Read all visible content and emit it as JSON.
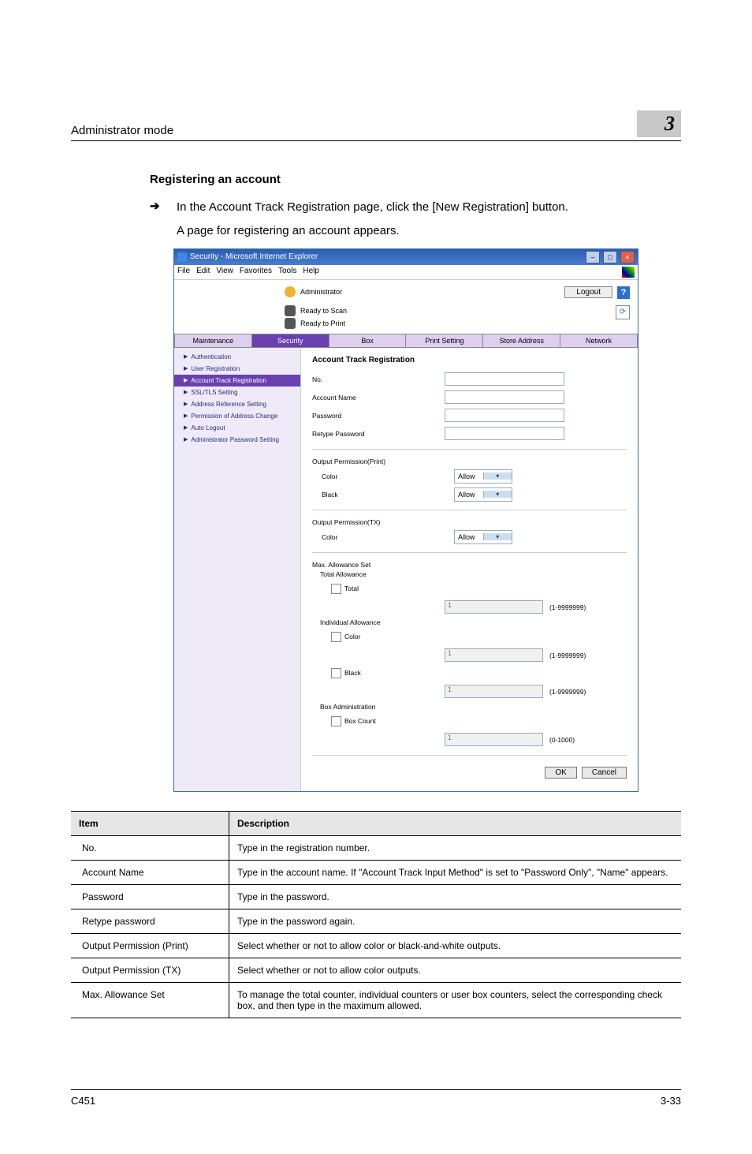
{
  "header": {
    "title": "Administrator mode",
    "chapter": "3"
  },
  "section_heading": "Registering an account",
  "step1": "In the Account Track Registration page, click the [New Registration] button.",
  "step1b": "A page for registering an account appears.",
  "ie": {
    "title": "Security - Microsoft Internet Explorer",
    "menu": {
      "file": "File",
      "edit": "Edit",
      "view": "View",
      "favorites": "Favorites",
      "tools": "Tools",
      "help": "Help"
    },
    "admin": "Administrator",
    "ready_scan": "Ready to Scan",
    "ready_print": "Ready to Print",
    "logout": "Logout",
    "tabs": {
      "maintenance": "Maintenance",
      "security": "Security",
      "box": "Box",
      "print": "Print Setting",
      "store": "Store Address",
      "network": "Network"
    },
    "side": {
      "auth": "Authentication",
      "user_reg": "User Registration",
      "acct_reg": "Account Track Registration",
      "ssl": "SSL/TLS Setting",
      "addr_ref": "Address Reference Setting",
      "perm_change": "Permission of Address Change",
      "auto_logout": "Auto Logout",
      "admin_pw": "Administrator Password Setting"
    },
    "panel": {
      "heading": "Account Track Registration",
      "no": "No.",
      "acct_name": "Account Name",
      "password": "Password",
      "retype_pw": "Retype Password",
      "out_perm_print": "Output Permission(Print)",
      "color": "Color",
      "black": "Black",
      "out_perm_tx": "Output Permission(TX)",
      "allow": "Allow",
      "max_set": "Max. Allowance Set",
      "total_allow": "Total Allowance",
      "total": "Total",
      "indiv_allow": "Individual Allowance",
      "one_val": "1",
      "range_big": "(1-9999999)",
      "box_admin": "Box Administration",
      "box_count": "Box Count",
      "range_small": "(0-1000)",
      "ok": "OK",
      "cancel": "Cancel"
    }
  },
  "table": {
    "h_item": "Item",
    "h_desc": "Description",
    "rows": [
      {
        "item": "No.",
        "desc": "Type in the registration number."
      },
      {
        "item": "Account Name",
        "desc": "Type in the account name. If \"Account Track Input Method\" is set to \"Password Only\", \"Name\" appears."
      },
      {
        "item": "Password",
        "desc": "Type in the password."
      },
      {
        "item": "Retype password",
        "desc": "Type in the password again."
      },
      {
        "item": "Output Permission (Print)",
        "desc": "Select whether or not to allow color or black-and-white outputs."
      },
      {
        "item": "Output Permission (TX)",
        "desc": "Select whether or not to allow color outputs."
      },
      {
        "item": "Max. Allowance Set",
        "desc": "To manage the total counter, individual counters or user box counters, select the corresponding check box, and then type in the maximum allowed."
      }
    ]
  },
  "footer": {
    "model": "C451",
    "page": "3-33"
  }
}
